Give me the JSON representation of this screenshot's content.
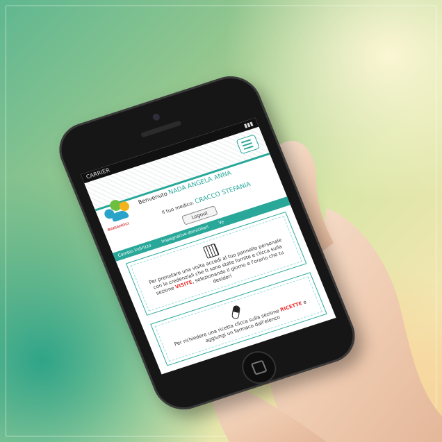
{
  "status_bar": {
    "carrier": "CARRIER"
  },
  "app": {
    "logo_text": "BAKIAMOCI",
    "welcome_prefix": "Benvenuto",
    "user_name": "NADA ANGELA ANNA",
    "doctor_prefix": "Il tuo medico:",
    "doctor_name": "CRACCO STEFANIA",
    "logout_label": "Logout",
    "tabs": [
      "Cambio indirizzo",
      "Impegnative domiciliari",
      "Ve"
    ],
    "card_visits": {
      "icon": "calendar-icon",
      "text_before": "Per prenotare una visita accedi al tuo pannello personale con le credenziali che ti sono state fornite e clicca sulla sezione",
      "highlight": "VISITE",
      "text_after": ", selezionando il giorno e l'orario che tu desideri"
    },
    "card_recipes": {
      "icon": "pill-icon",
      "text_before": "Per richiedere una ricetta clicca sulla sezione",
      "highlight": "RICETTE",
      "text_after": "e aggiungi un farmaco dall'elenco"
    }
  },
  "colors": {
    "accent": "#29a89a",
    "highlight": "#e33333"
  }
}
